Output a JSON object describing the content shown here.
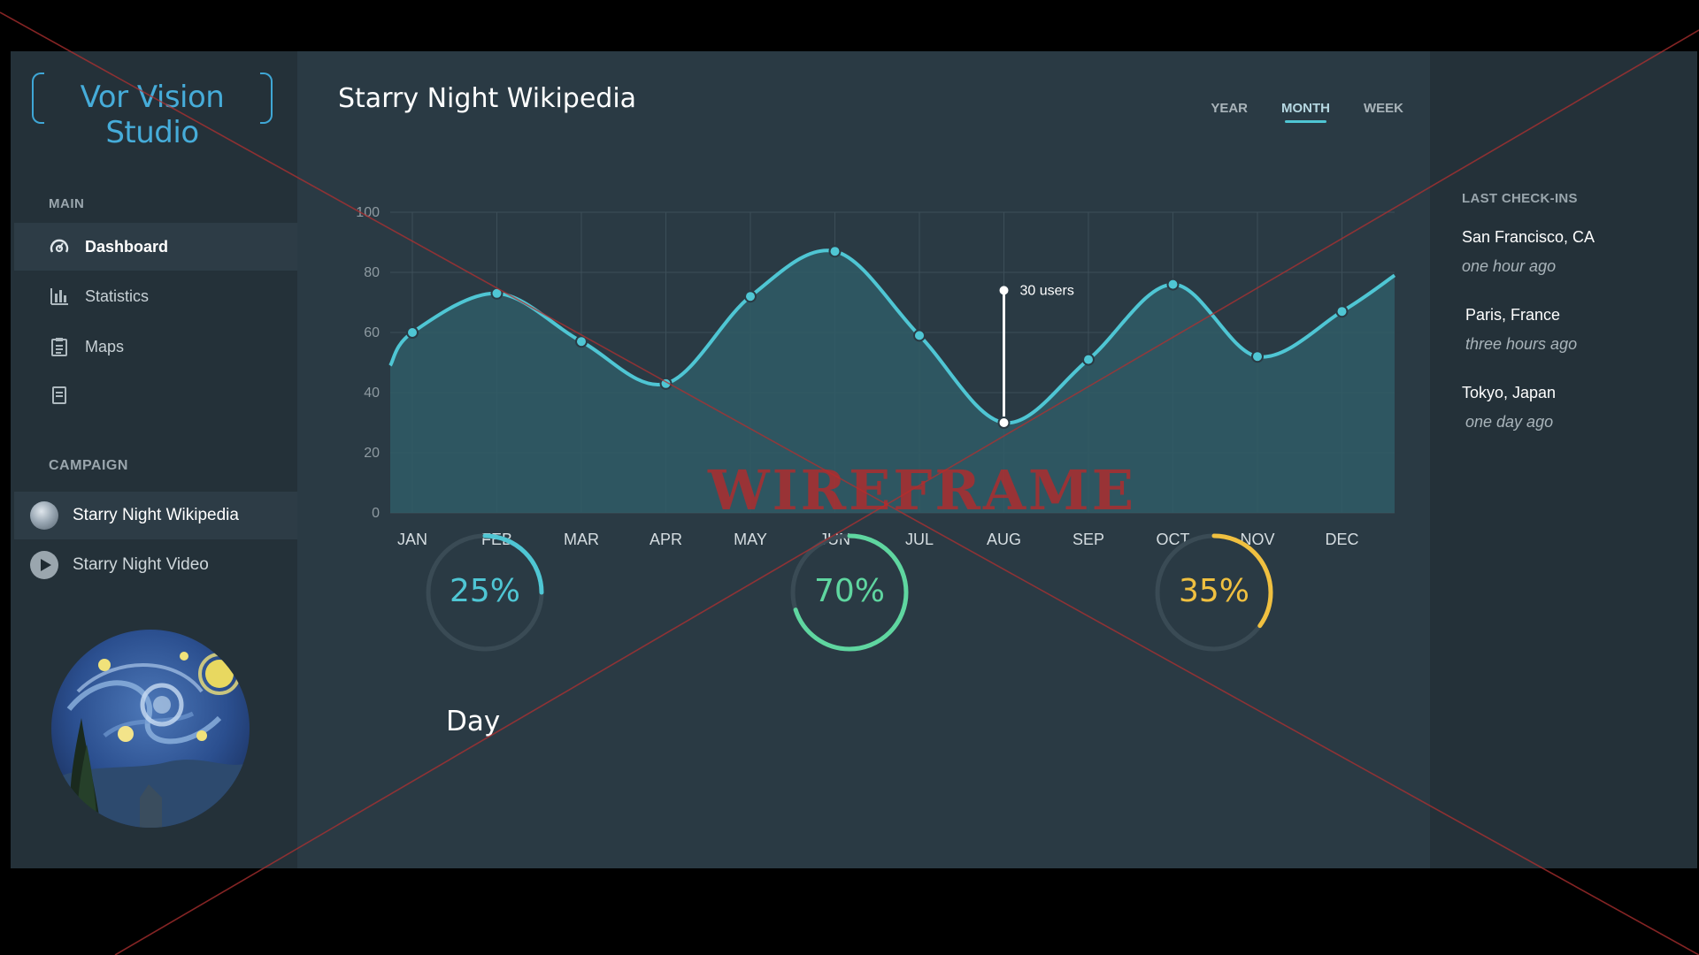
{
  "app": {
    "logo_text": "Vor Vision Studio"
  },
  "sidebar": {
    "main_label": "MAIN",
    "items": [
      {
        "label": "Dashboard",
        "icon": "dashboard-icon",
        "active": true
      },
      {
        "label": "Statistics",
        "icon": "bar-chart-icon",
        "active": false
      },
      {
        "label": "Maps",
        "icon": "clipboard-icon",
        "active": false
      },
      {
        "label": "",
        "icon": "document-icon",
        "active": false
      }
    ],
    "campaign_label": "CAMPAIGN",
    "campaigns": [
      {
        "label": "Starry Night Wikipedia",
        "icon": "globe-avatar",
        "active": true
      },
      {
        "label": "Starry Night Video",
        "icon": "play-icon",
        "active": false
      }
    ]
  },
  "main": {
    "title": "Starry Night Wikipedia",
    "tabs": [
      {
        "label": "YEAR",
        "active": false
      },
      {
        "label": "MONTH",
        "active": true
      },
      {
        "label": "WEEK",
        "active": false
      }
    ],
    "tooltip": "30 users",
    "gauges": [
      {
        "label": "25%",
        "value": 25,
        "color": "#4fc6d4"
      },
      {
        "label": "70%",
        "value": 70,
        "color": "#5fd6a0"
      },
      {
        "label": "35%",
        "value": 35,
        "color": "#f0c040"
      }
    ],
    "day_label": "Day"
  },
  "chart_data": {
    "type": "area",
    "categories": [
      "JAN",
      "FEB",
      "MAR",
      "APR",
      "MAY",
      "JUN",
      "JUL",
      "AUG",
      "SEP",
      "OCT",
      "NOV",
      "DEC"
    ],
    "values": [
      60,
      73,
      57,
      43,
      72,
      87,
      59,
      30,
      51,
      76,
      52,
      67
    ],
    "ylim": [
      0,
      100
    ],
    "yticks": [
      0,
      20,
      40,
      60,
      80,
      100
    ],
    "highlight": {
      "category": "AUG",
      "value": 30,
      "label": "30 users"
    },
    "grid": true,
    "colors": {
      "line": "#4fc6d4",
      "fill": "#2f5c66"
    }
  },
  "right_panel": {
    "title": "LAST CHECK-INS",
    "checkins": [
      {
        "city": "San Francisco, CA",
        "time": "one hour ago"
      },
      {
        "city": "Paris, France",
        "time": "three hours ago"
      },
      {
        "city": "Tokyo, Japan",
        "time": "one day ago"
      }
    ]
  },
  "watermark": "WIREFRAME"
}
